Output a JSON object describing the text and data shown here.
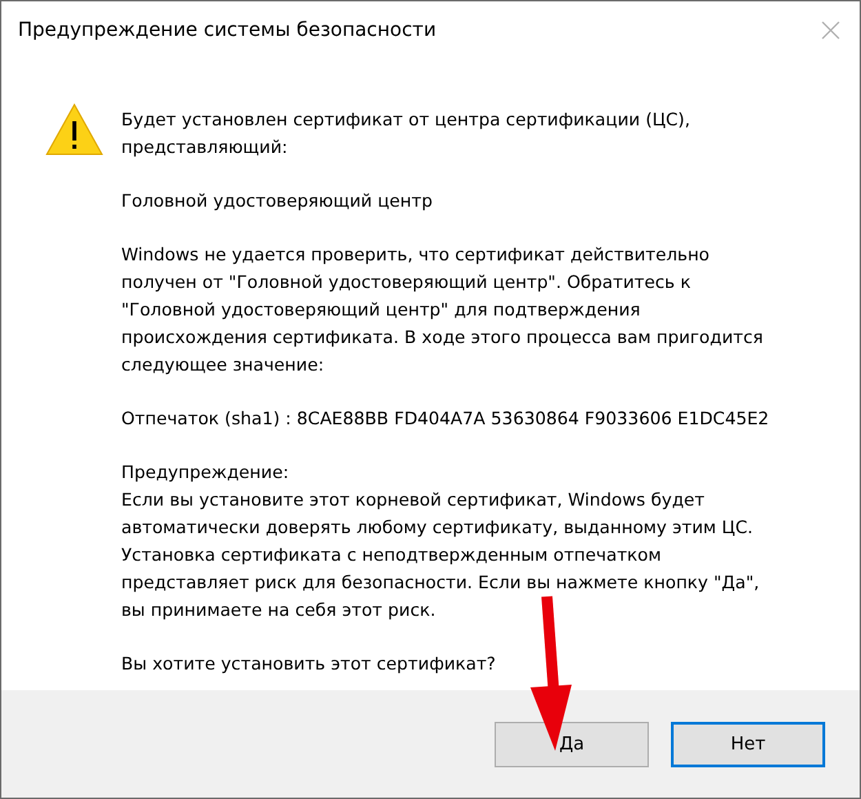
{
  "window": {
    "title": "Предупреждение системы безопасности"
  },
  "message": {
    "paragraphs": [
      "Будет установлен сертификат от центра сертификации (ЦС),\nпредставляющий:",
      "Головной удостоверяющий центр",
      "Windows не удается проверить, что сертификат действительно\nполучен от \"Головной удостоверяющий центр\". Обратитесь к\n\"Головной удостоверяющий центр\" для подтверждения\nпроисхождения сертификата. В ходе этого процесса вам пригодится\nследующее значение:",
      "Отпечаток (sha1) : 8CAE88BB FD404A7A 53630864 F9033606 E1DC45E2",
      "Предупреждение:\nЕсли вы установите этот корневой сертификат, Windows будет\nавтоматически доверять любому сертификату, выданному этим ЦС.\nУстановка сертификата с неподтвержденным отпечатком\nпредставляет риск для безопасности. Если вы нажмете кнопку \"Да\",\nвы принимаете на себя этот риск.",
      "Вы хотите установить этот сертификат?"
    ]
  },
  "buttons": [
    {
      "label": "Да",
      "default": false
    },
    {
      "label": "Нет",
      "default": true
    }
  ]
}
